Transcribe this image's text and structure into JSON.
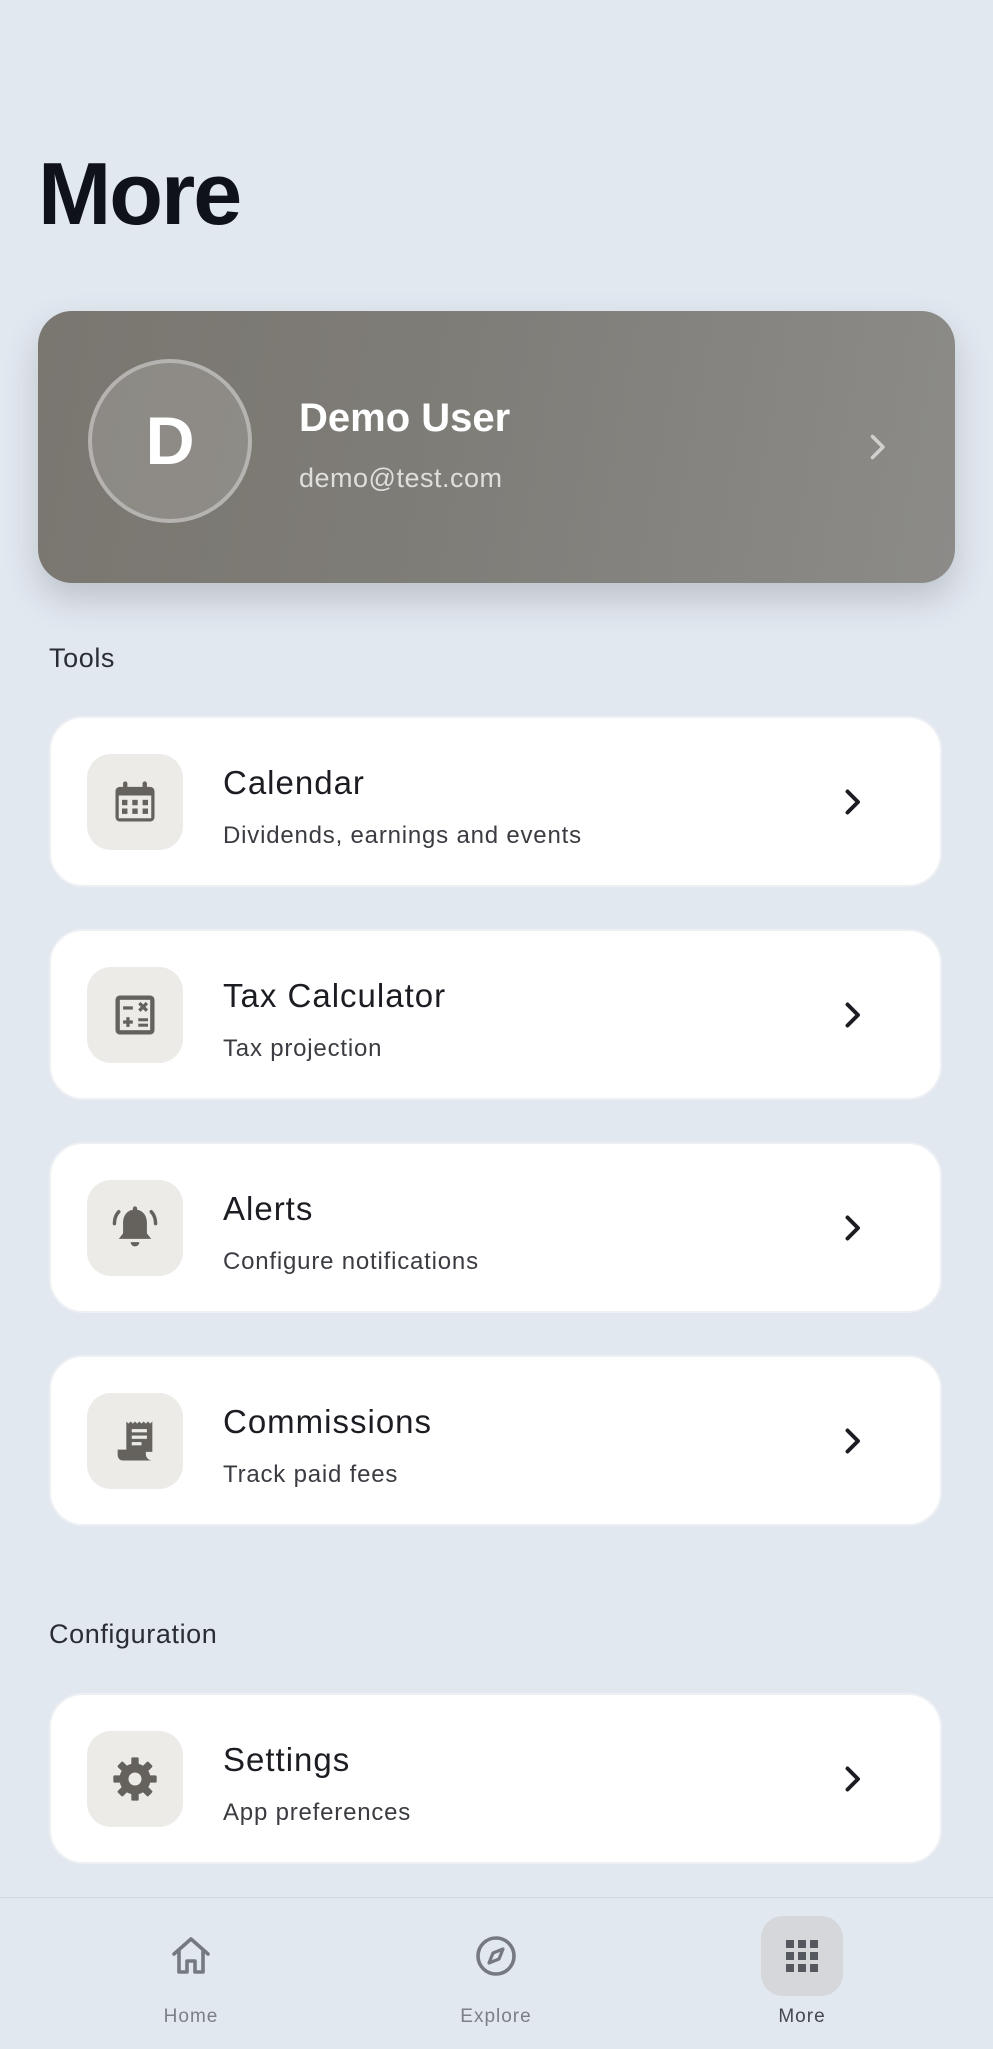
{
  "page": {
    "title": "More"
  },
  "profile": {
    "initial": "D",
    "name": "Demo User",
    "email": "demo@test.com"
  },
  "sections": {
    "tools": {
      "label": "Tools"
    },
    "configuration": {
      "label": "Configuration"
    }
  },
  "tools": [
    {
      "title": "Calendar",
      "subtitle": "Dividends, earnings and events",
      "icon": "calendar-icon"
    },
    {
      "title": "Tax Calculator",
      "subtitle": "Tax projection",
      "icon": "calculator-icon"
    },
    {
      "title": "Alerts",
      "subtitle": "Configure notifications",
      "icon": "bell-icon"
    },
    {
      "title": "Commissions",
      "subtitle": "Track paid fees",
      "icon": "receipt-icon"
    }
  ],
  "configuration": [
    {
      "title": "Settings",
      "subtitle": "App preferences",
      "icon": "gear-icon"
    }
  ],
  "nav": [
    {
      "label": "Home",
      "icon": "home-icon",
      "active": false
    },
    {
      "label": "Explore",
      "icon": "compass-icon",
      "active": false
    },
    {
      "label": "More",
      "icon": "grid-icon",
      "active": true
    }
  ],
  "colors": {
    "background": "#e2e8f0",
    "profile_card": "#7f7d78",
    "icon_tile": "#ecebe8",
    "icon": "#65625d",
    "active_nav_bg": "#d5d7da"
  }
}
